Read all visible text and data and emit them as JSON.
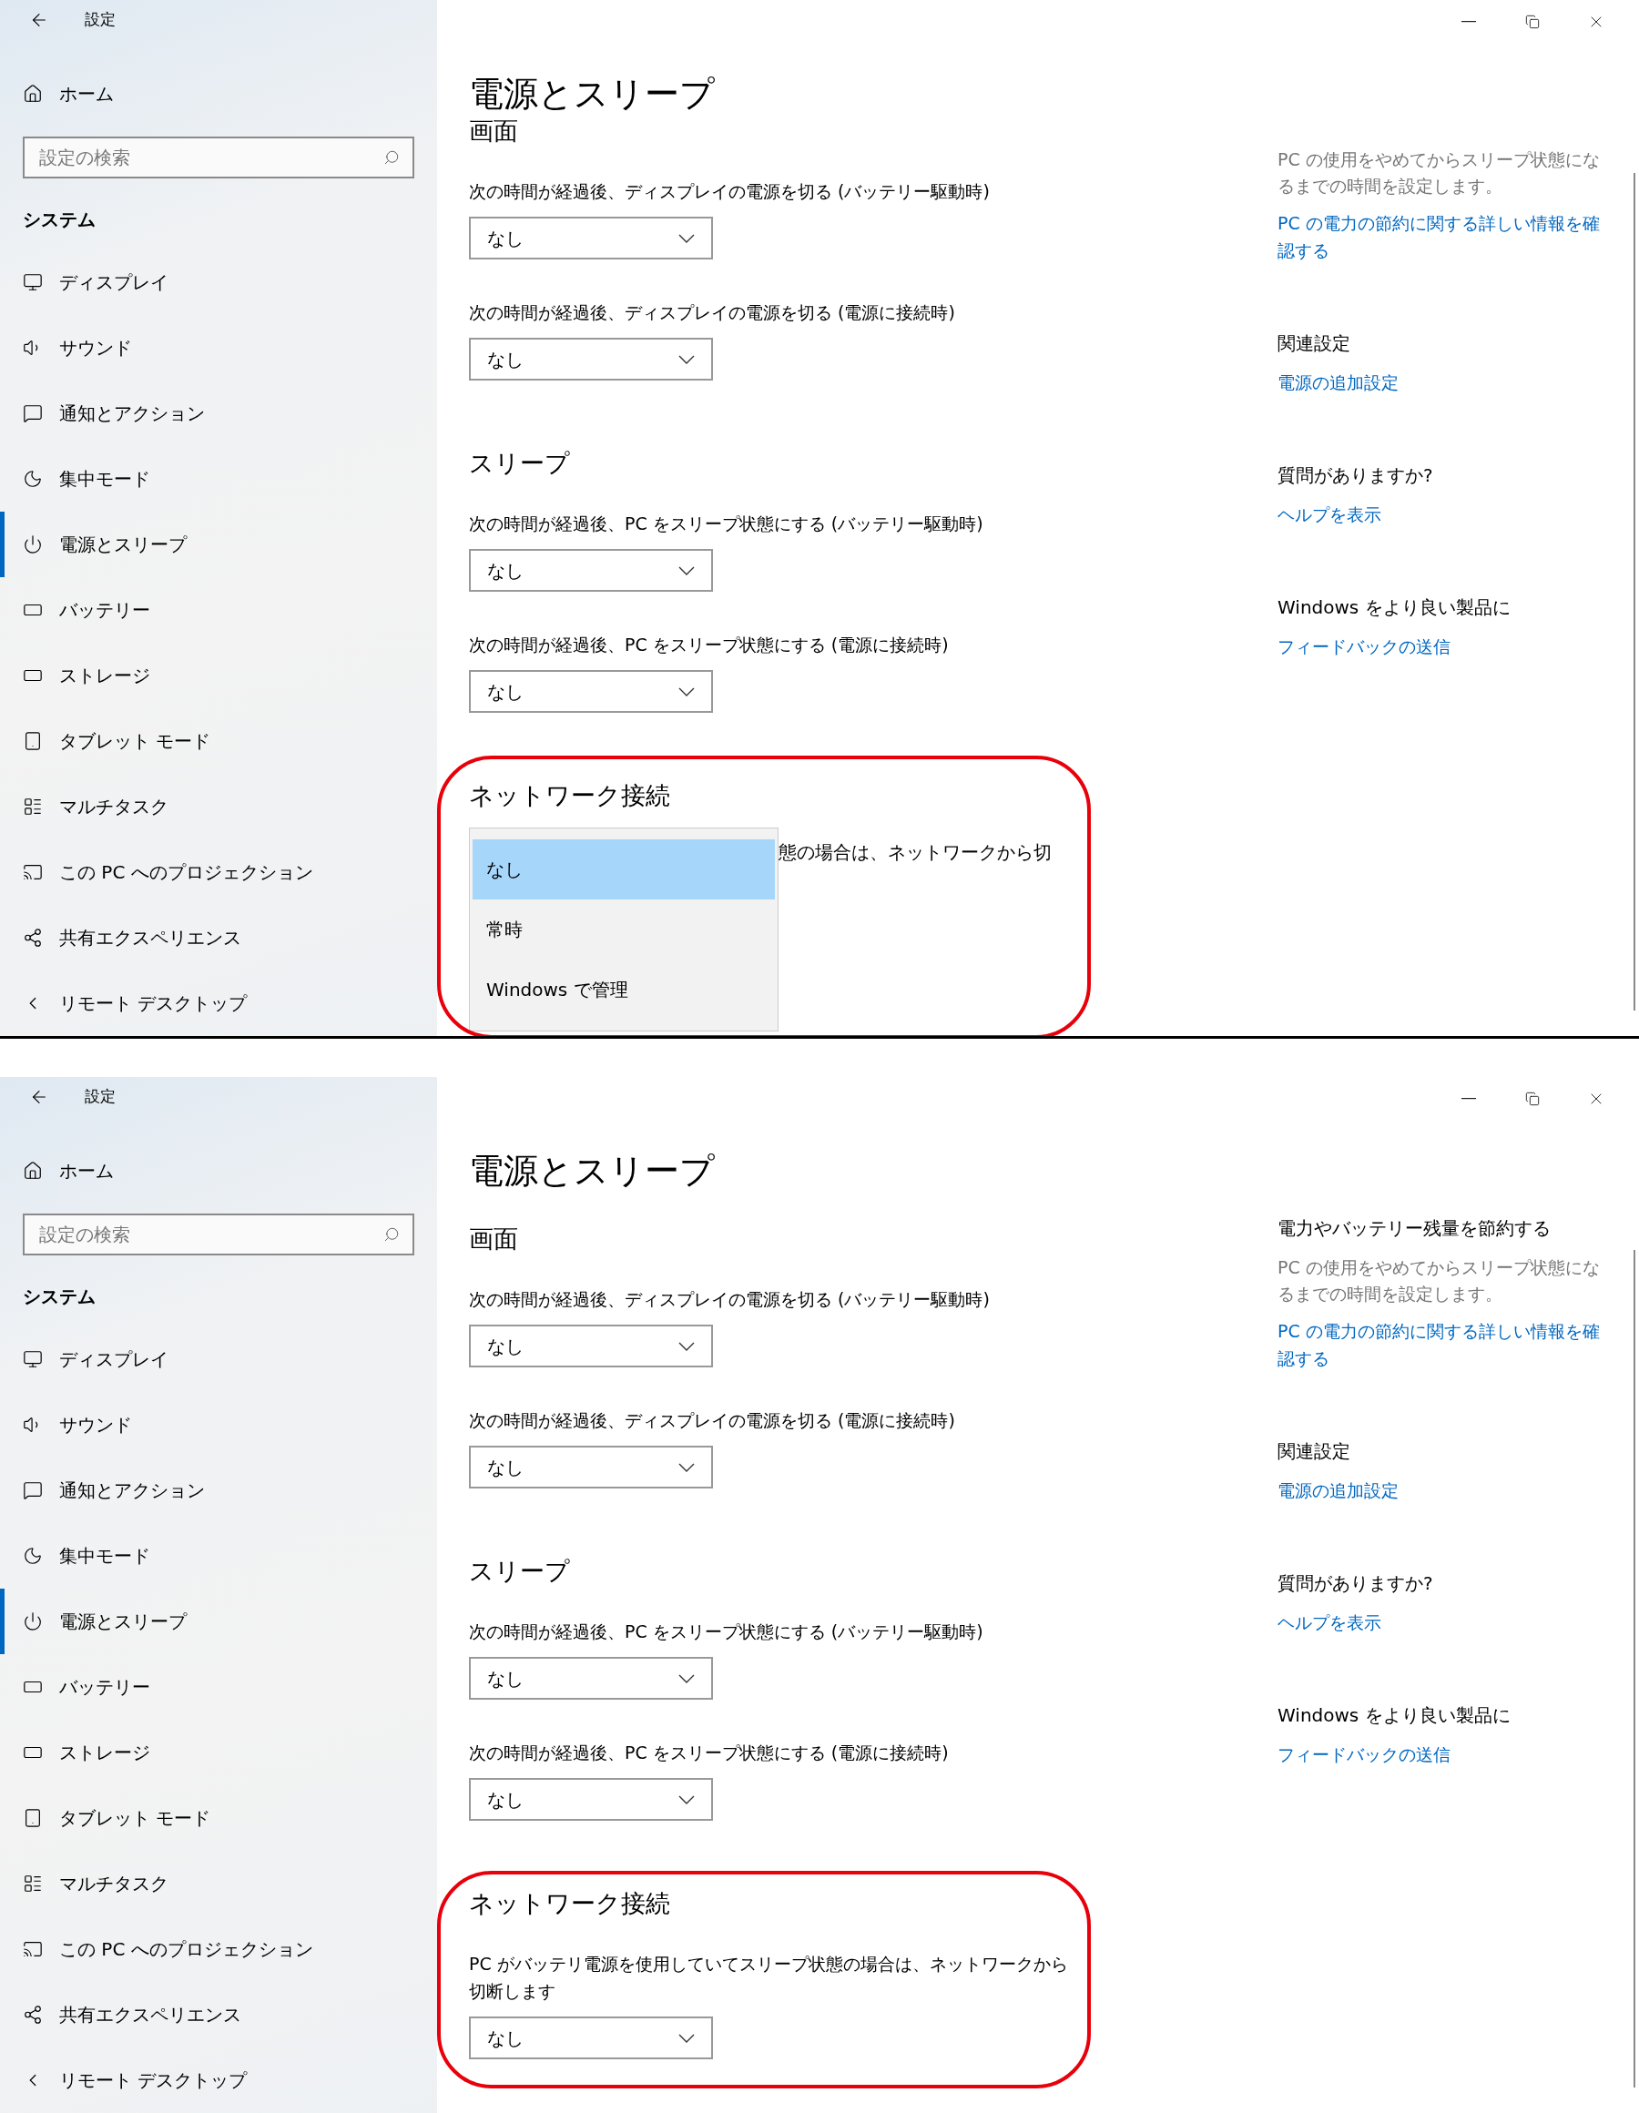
{
  "screens": [
    {
      "title": "設定",
      "home": "ホーム",
      "search_placeholder": "設定の検索",
      "category": "システム",
      "nav": [
        {
          "label": "ディスプレイ",
          "selected": false
        },
        {
          "label": "サウンド",
          "selected": false
        },
        {
          "label": "通知とアクション",
          "selected": false
        },
        {
          "label": "集中モード",
          "selected": false
        },
        {
          "label": "電源とスリープ",
          "selected": true
        },
        {
          "label": "バッテリー",
          "selected": false
        },
        {
          "label": "ストレージ",
          "selected": false
        },
        {
          "label": "タブレット モード",
          "selected": false
        },
        {
          "label": "マルチタスク",
          "selected": false
        },
        {
          "label": "この PC へのプロジェクション",
          "selected": false
        },
        {
          "label": "共有エクスペリエンス",
          "selected": false
        },
        {
          "label": "リモート デスクトップ",
          "selected": false
        }
      ],
      "page_title": "電源とスリープ",
      "scrolled": true,
      "sections": [
        {
          "heading": "画面",
          "highlighted": false,
          "settings": [
            {
              "label": "次の時間が経過後、ディスプレイの電源を切る (バッテリー駆動時)",
              "value": "なし"
            },
            {
              "label": "次の時間が経過後、ディスプレイの電源を切る (電源に接続時)",
              "value": "なし"
            }
          ]
        },
        {
          "heading": "スリープ",
          "highlighted": false,
          "settings": [
            {
              "label": "次の時間が経過後、PC をスリープ状態にする (バッテリー駆動時)",
              "value": "なし"
            },
            {
              "label": "次の時間が経過後、PC をスリープ状態にする (電源に接続時)",
              "value": "なし"
            }
          ]
        },
        {
          "heading": "ネットワーク接続",
          "highlighted": true,
          "settings": [
            {
              "label": "態の場合は、ネットワークから切",
              "options": [
                {
                  "label": "なし",
                  "selected": true
                },
                {
                  "label": "常時",
                  "selected": false
                },
                {
                  "label": "Windows で管理",
                  "selected": false
                }
              ]
            }
          ]
        }
      ],
      "aside": {
        "description": "PC の使用をやめてからスリープ状態になるまでの時間を設定します。",
        "link": "PC の電力の節約に関する詳しい情報を確認する",
        "groups": [
          {
            "heading": "関連設定",
            "link": "電源の追加設定"
          },
          {
            "heading": "質問がありますか?",
            "link": "ヘルプを表示"
          },
          {
            "heading": "Windows をより良い製品に",
            "link": "フィードバックの送信"
          }
        ]
      }
    },
    {
      "title": "設定",
      "home": "ホーム",
      "search_placeholder": "設定の検索",
      "category": "システム",
      "nav": [
        {
          "label": "ディスプレイ",
          "selected": false
        },
        {
          "label": "サウンド",
          "selected": false
        },
        {
          "label": "通知とアクション",
          "selected": false
        },
        {
          "label": "集中モード",
          "selected": false
        },
        {
          "label": "電源とスリープ",
          "selected": true
        },
        {
          "label": "バッテリー",
          "selected": false
        },
        {
          "label": "ストレージ",
          "selected": false
        },
        {
          "label": "タブレット モード",
          "selected": false
        },
        {
          "label": "マルチタスク",
          "selected": false
        },
        {
          "label": "この PC へのプロジェクション",
          "selected": false
        },
        {
          "label": "共有エクスペリエンス",
          "selected": false
        },
        {
          "label": "リモート デスクトップ",
          "selected": false
        }
      ],
      "page_title": "電源とスリープ",
      "scrolled": false,
      "sections": [
        {
          "heading": "画面",
          "highlighted": false,
          "settings": [
            {
              "label": "次の時間が経過後、ディスプレイの電源を切る (バッテリー駆動時)",
              "value": "なし"
            },
            {
              "label": "次の時間が経過後、ディスプレイの電源を切る (電源に接続時)",
              "value": "なし"
            }
          ]
        },
        {
          "heading": "スリープ",
          "highlighted": false,
          "settings": [
            {
              "label": "次の時間が経過後、PC をスリープ状態にする (バッテリー駆動時)",
              "value": "なし"
            },
            {
              "label": "次の時間が経過後、PC をスリープ状態にする (電源に接続時)",
              "value": "なし"
            }
          ]
        },
        {
          "heading": "ネットワーク接続",
          "highlighted": true,
          "settings": [
            {
              "label": "PC がバッテリ電源を使用していてスリープ状態の場合は、ネットワークから切断します",
              "value": "なし"
            }
          ]
        }
      ],
      "aside": {
        "heading": "電力やバッテリー残量を節約する",
        "description": "PC の使用をやめてからスリープ状態になるまでの時間を設定します。",
        "link": "PC の電力の節約に関する詳しい情報を確認する",
        "groups": [
          {
            "heading": "関連設定",
            "link": "電源の追加設定"
          },
          {
            "heading": "質問がありますか?",
            "link": "ヘルプを表示"
          },
          {
            "heading": "Windows をより良い製品に",
            "link": "フィードバックの送信"
          }
        ]
      }
    }
  ]
}
